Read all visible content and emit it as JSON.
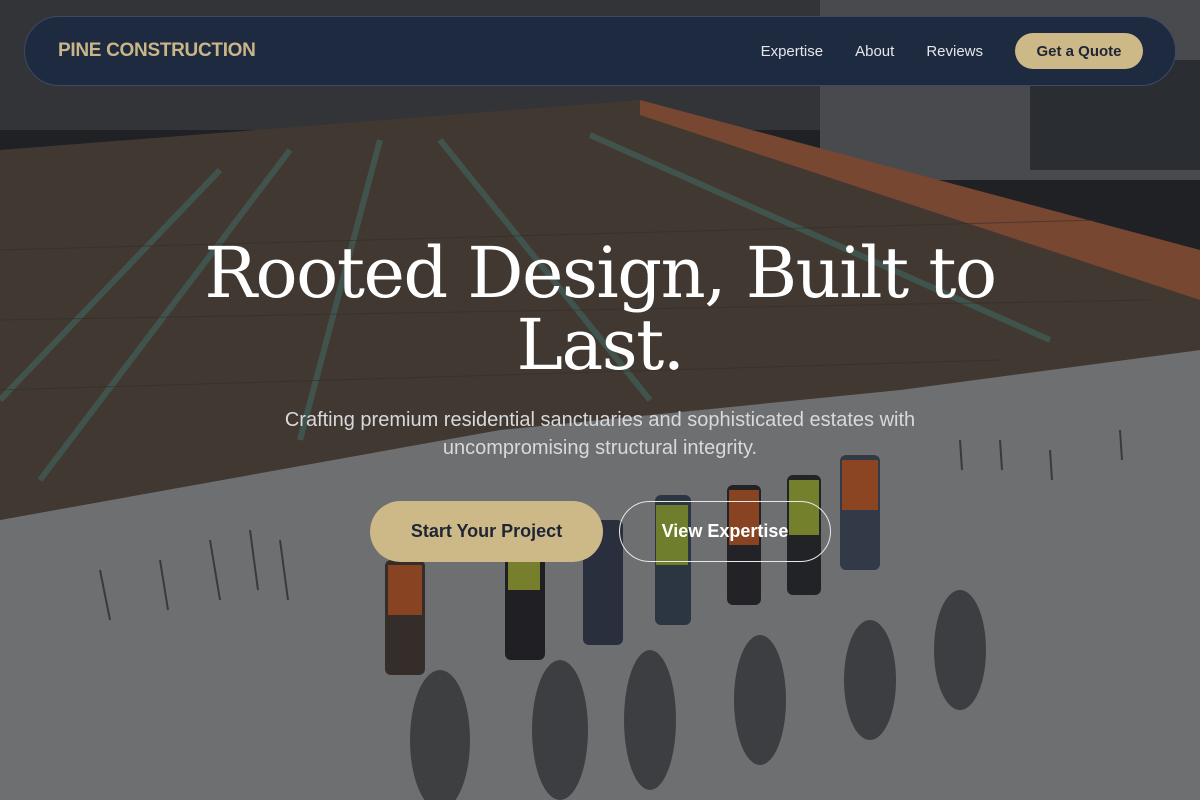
{
  "brand": {
    "name": "PINE CONSTRUCTION"
  },
  "nav": {
    "links": [
      {
        "label": "Expertise"
      },
      {
        "label": "About"
      },
      {
        "label": "Reviews"
      }
    ],
    "cta_label": "Get a Quote"
  },
  "hero": {
    "title": "Rooted Design, Built to Last.",
    "subtitle": "Crafting premium residential sanctuaries and sophisticated estates with uncompromising structural integrity.",
    "primary_cta": "Start Your Project",
    "secondary_cta": "View Expertise"
  },
  "colors": {
    "accent": "#cdb987",
    "navbar_bg": "#1e2a40",
    "text_dark": "#1e2535"
  }
}
